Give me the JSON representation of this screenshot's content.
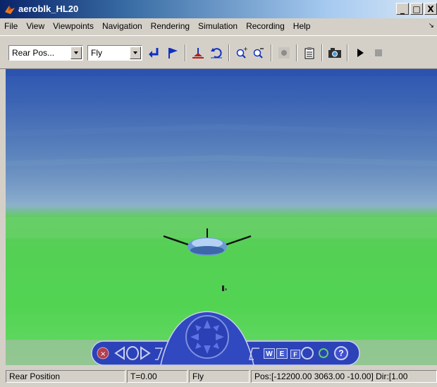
{
  "window": {
    "title": "aeroblk_HL20",
    "min_label": "_",
    "max_label": "□",
    "close_label": "X"
  },
  "menu": {
    "items": [
      "File",
      "View",
      "Viewpoints",
      "Navigation",
      "Rendering",
      "Simulation",
      "Recording",
      "Help"
    ]
  },
  "toolbar": {
    "viewpoint_value": "Rear Pos...",
    "navigation_mode_value": "Fly"
  },
  "navpanel": {
    "w_label": "W",
    "e_label": "E",
    "f_label": "F",
    "help_label": "?"
  },
  "status": {
    "viewpoint": "Rear Position",
    "time": "T=0.00",
    "mode": "Fly",
    "position": "Pos:[-12200.00 3063.00 -10.00] Dir:[1.00"
  },
  "colors": {
    "sky_top": "#2e56b0",
    "sky_horizon": "#8cb0cc",
    "ground": "#55d055",
    "titlebar": "#0a246a",
    "nav_panel": "#2c42b8"
  }
}
